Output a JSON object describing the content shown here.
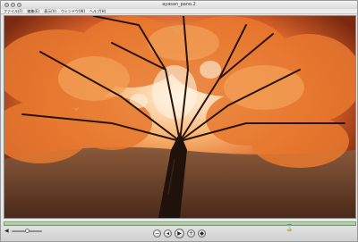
{
  "window": {
    "title": "ayasan_pano.2"
  },
  "menu": {
    "items": [
      {
        "label": "ファイル(F)"
      },
      {
        "label": "編集(E)"
      },
      {
        "label": "表示(V)"
      },
      {
        "label": "ウィンドウ(W)"
      },
      {
        "label": "ヘルプ(H)"
      }
    ]
  },
  "viewer": {
    "scene": "panorama-autumn-maple-tree"
  },
  "controls": {
    "volume_level": 0.5,
    "buttons": [
      {
        "name": "zoom-out-button",
        "glyph": "−"
      },
      {
        "name": "rewind-button",
        "glyph": "◂"
      },
      {
        "name": "play-button",
        "glyph": "▶"
      },
      {
        "name": "zoom-in-button",
        "glyph": "+"
      },
      {
        "name": "hotspot-button",
        "glyph": "◆"
      }
    ],
    "hourglass_icon": "⌛"
  }
}
